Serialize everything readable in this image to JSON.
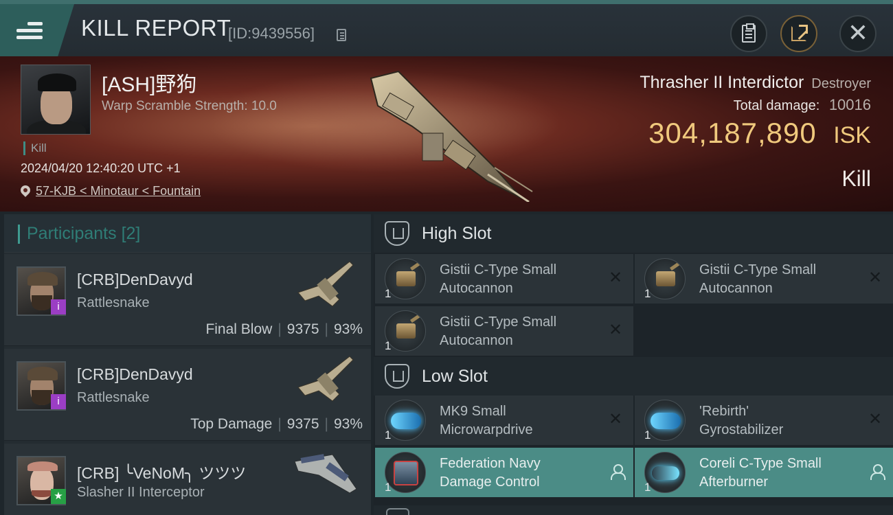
{
  "header": {
    "title": "KILL REPORT",
    "report_id": "[ID:9439556]"
  },
  "victim": {
    "name": "[ASH]野狗",
    "warp_scramble": "Warp Scramble Strength: 10.0",
    "kill_tag": "Kill",
    "datetime": "2024/04/20 12:40:20 UTC +1",
    "location": "57-KJB < Minotaur < Fountain",
    "ship_name": "Thrasher II Interdictor",
    "ship_class": "Destroyer",
    "damage_label": "Total damage:",
    "damage_value": "10016",
    "isk_value": "304,187,890",
    "isk_unit": "ISK",
    "result": "Kill"
  },
  "participants": {
    "label": "Participants",
    "count": "[2]",
    "rows": [
      {
        "name": "[CRB]DenDavyd",
        "ship": "Rattlesnake",
        "role": "Final Blow",
        "damage": "9375",
        "percent": "93%",
        "badge": "i"
      },
      {
        "name": "[CRB]DenDavyd",
        "ship": "Rattlesnake",
        "role": "Top Damage",
        "damage": "9375",
        "percent": "93%",
        "badge": "i"
      },
      {
        "name": "[CRB] ╰VeNoM╮ ツツツ",
        "ship": "Slasher II Interceptor",
        "badge": "★"
      }
    ]
  },
  "fitting": {
    "high_slot": {
      "label": "High Slot",
      "modules": [
        {
          "name_line1": "Gistii C-Type Small",
          "name_line2": "Autocannon",
          "qty": "1"
        },
        {
          "name_line1": "Gistii C-Type Small",
          "name_line2": "Autocannon",
          "qty": "1"
        },
        {
          "name_line1": "Gistii C-Type Small",
          "name_line2": "Autocannon",
          "qty": "1"
        }
      ]
    },
    "low_slot": {
      "label": "Low Slot",
      "modules": [
        {
          "name_line1": "MK9 Small",
          "name_line2": "Microwarpdrive",
          "qty": "1"
        },
        {
          "name_line1": "'Rebirth'",
          "name_line2": "Gyrostabilizer",
          "qty": "1"
        },
        {
          "name_line1": "Federation Navy",
          "name_line2": "Damage Control",
          "qty": "1"
        },
        {
          "name_line1": "Coreli C-Type Small",
          "name_line2": "Afterburner",
          "qty": "1"
        }
      ]
    }
  },
  "icons": {
    "destroyed": "✕"
  },
  "colors": {
    "accent": "#3f9b91",
    "isk": "#f0c97d",
    "dropped_module_bg": "#4b8c86",
    "final_blow_badge": "#9b3ec4",
    "star_badge": "#27a045"
  }
}
